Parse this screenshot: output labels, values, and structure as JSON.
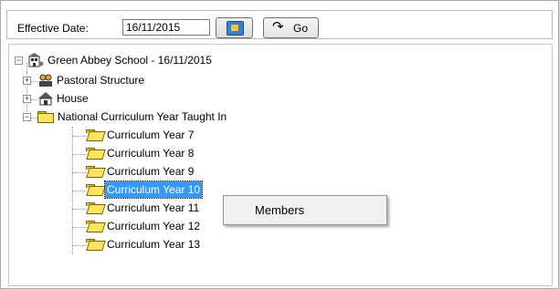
{
  "toolbar": {
    "effective_date_label": "Effective Date:",
    "effective_date_value": "16/11/2015",
    "go_label": "Go"
  },
  "tree": {
    "root": "Green Abbey School - 16/11/2015",
    "nodes": [
      {
        "label": "Pastoral Structure"
      },
      {
        "label": "House"
      },
      {
        "label": "National Curriculum Year Taught In"
      }
    ],
    "children": [
      {
        "label": "Curriculum Year  7"
      },
      {
        "label": "Curriculum Year  8"
      },
      {
        "label": "Curriculum Year  9"
      },
      {
        "label": "Curriculum Year 10",
        "selected": true
      },
      {
        "label": "Curriculum Year 11"
      },
      {
        "label": "Curriculum Year 12"
      },
      {
        "label": "Curriculum Year 13"
      }
    ]
  },
  "context_menu": {
    "items": [
      {
        "label": "Members"
      }
    ]
  }
}
